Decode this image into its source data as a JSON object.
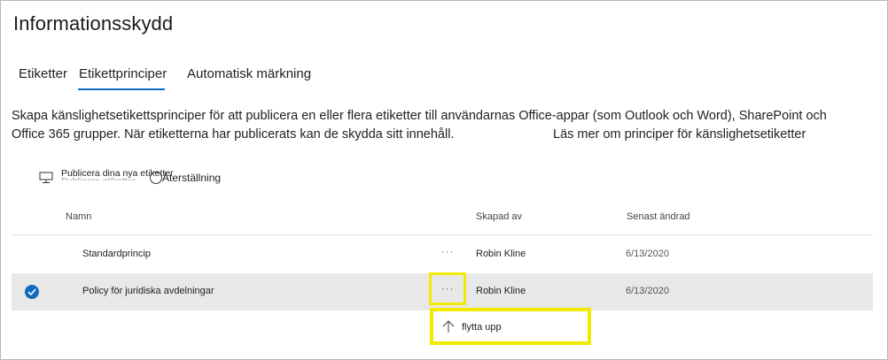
{
  "page": {
    "title": "Informationsskydd"
  },
  "tabs": [
    {
      "label": "Etiketter"
    },
    {
      "label": "Etikettprinciper"
    },
    {
      "label": "Automatisk märkning"
    }
  ],
  "description": {
    "line1": "Skapa känslighetsetikettsprinciper för att publicera en eller flera etiketter till användarnas Office-appar (som Outlook och Word), SharePoint och",
    "line2": "Office 365 grupper. När etiketterna har publicerats kan de skydda sitt innehåll.",
    "link": "Läs mer om principer för känslighetsetiketter"
  },
  "toolbar": {
    "publish_label": "Publicera dina nya etiketter",
    "publish_ghost": "Publicera etiketter",
    "reset_label": "Återställning"
  },
  "table": {
    "headers": {
      "name": "Namn",
      "created_by": "Skapad av",
      "modified": "Senast ändrad"
    },
    "rows": [
      {
        "name": "Standardprincip",
        "more": "···",
        "created_by": "Robin Kline",
        "modified": "6/13/2020"
      },
      {
        "name": "Policy för juridiska avdelningar",
        "more": "···",
        "created_by": "Robin Kline",
        "modified": "6/13/2020",
        "selected": true
      }
    ]
  },
  "context_menu": {
    "items": [
      {
        "label": "flytta upp",
        "icon": "arrow-up-icon"
      }
    ]
  },
  "colors": {
    "accent": "#0f6cbd",
    "highlight": "#f2ea00",
    "selected_row": "#e8e8e8"
  }
}
